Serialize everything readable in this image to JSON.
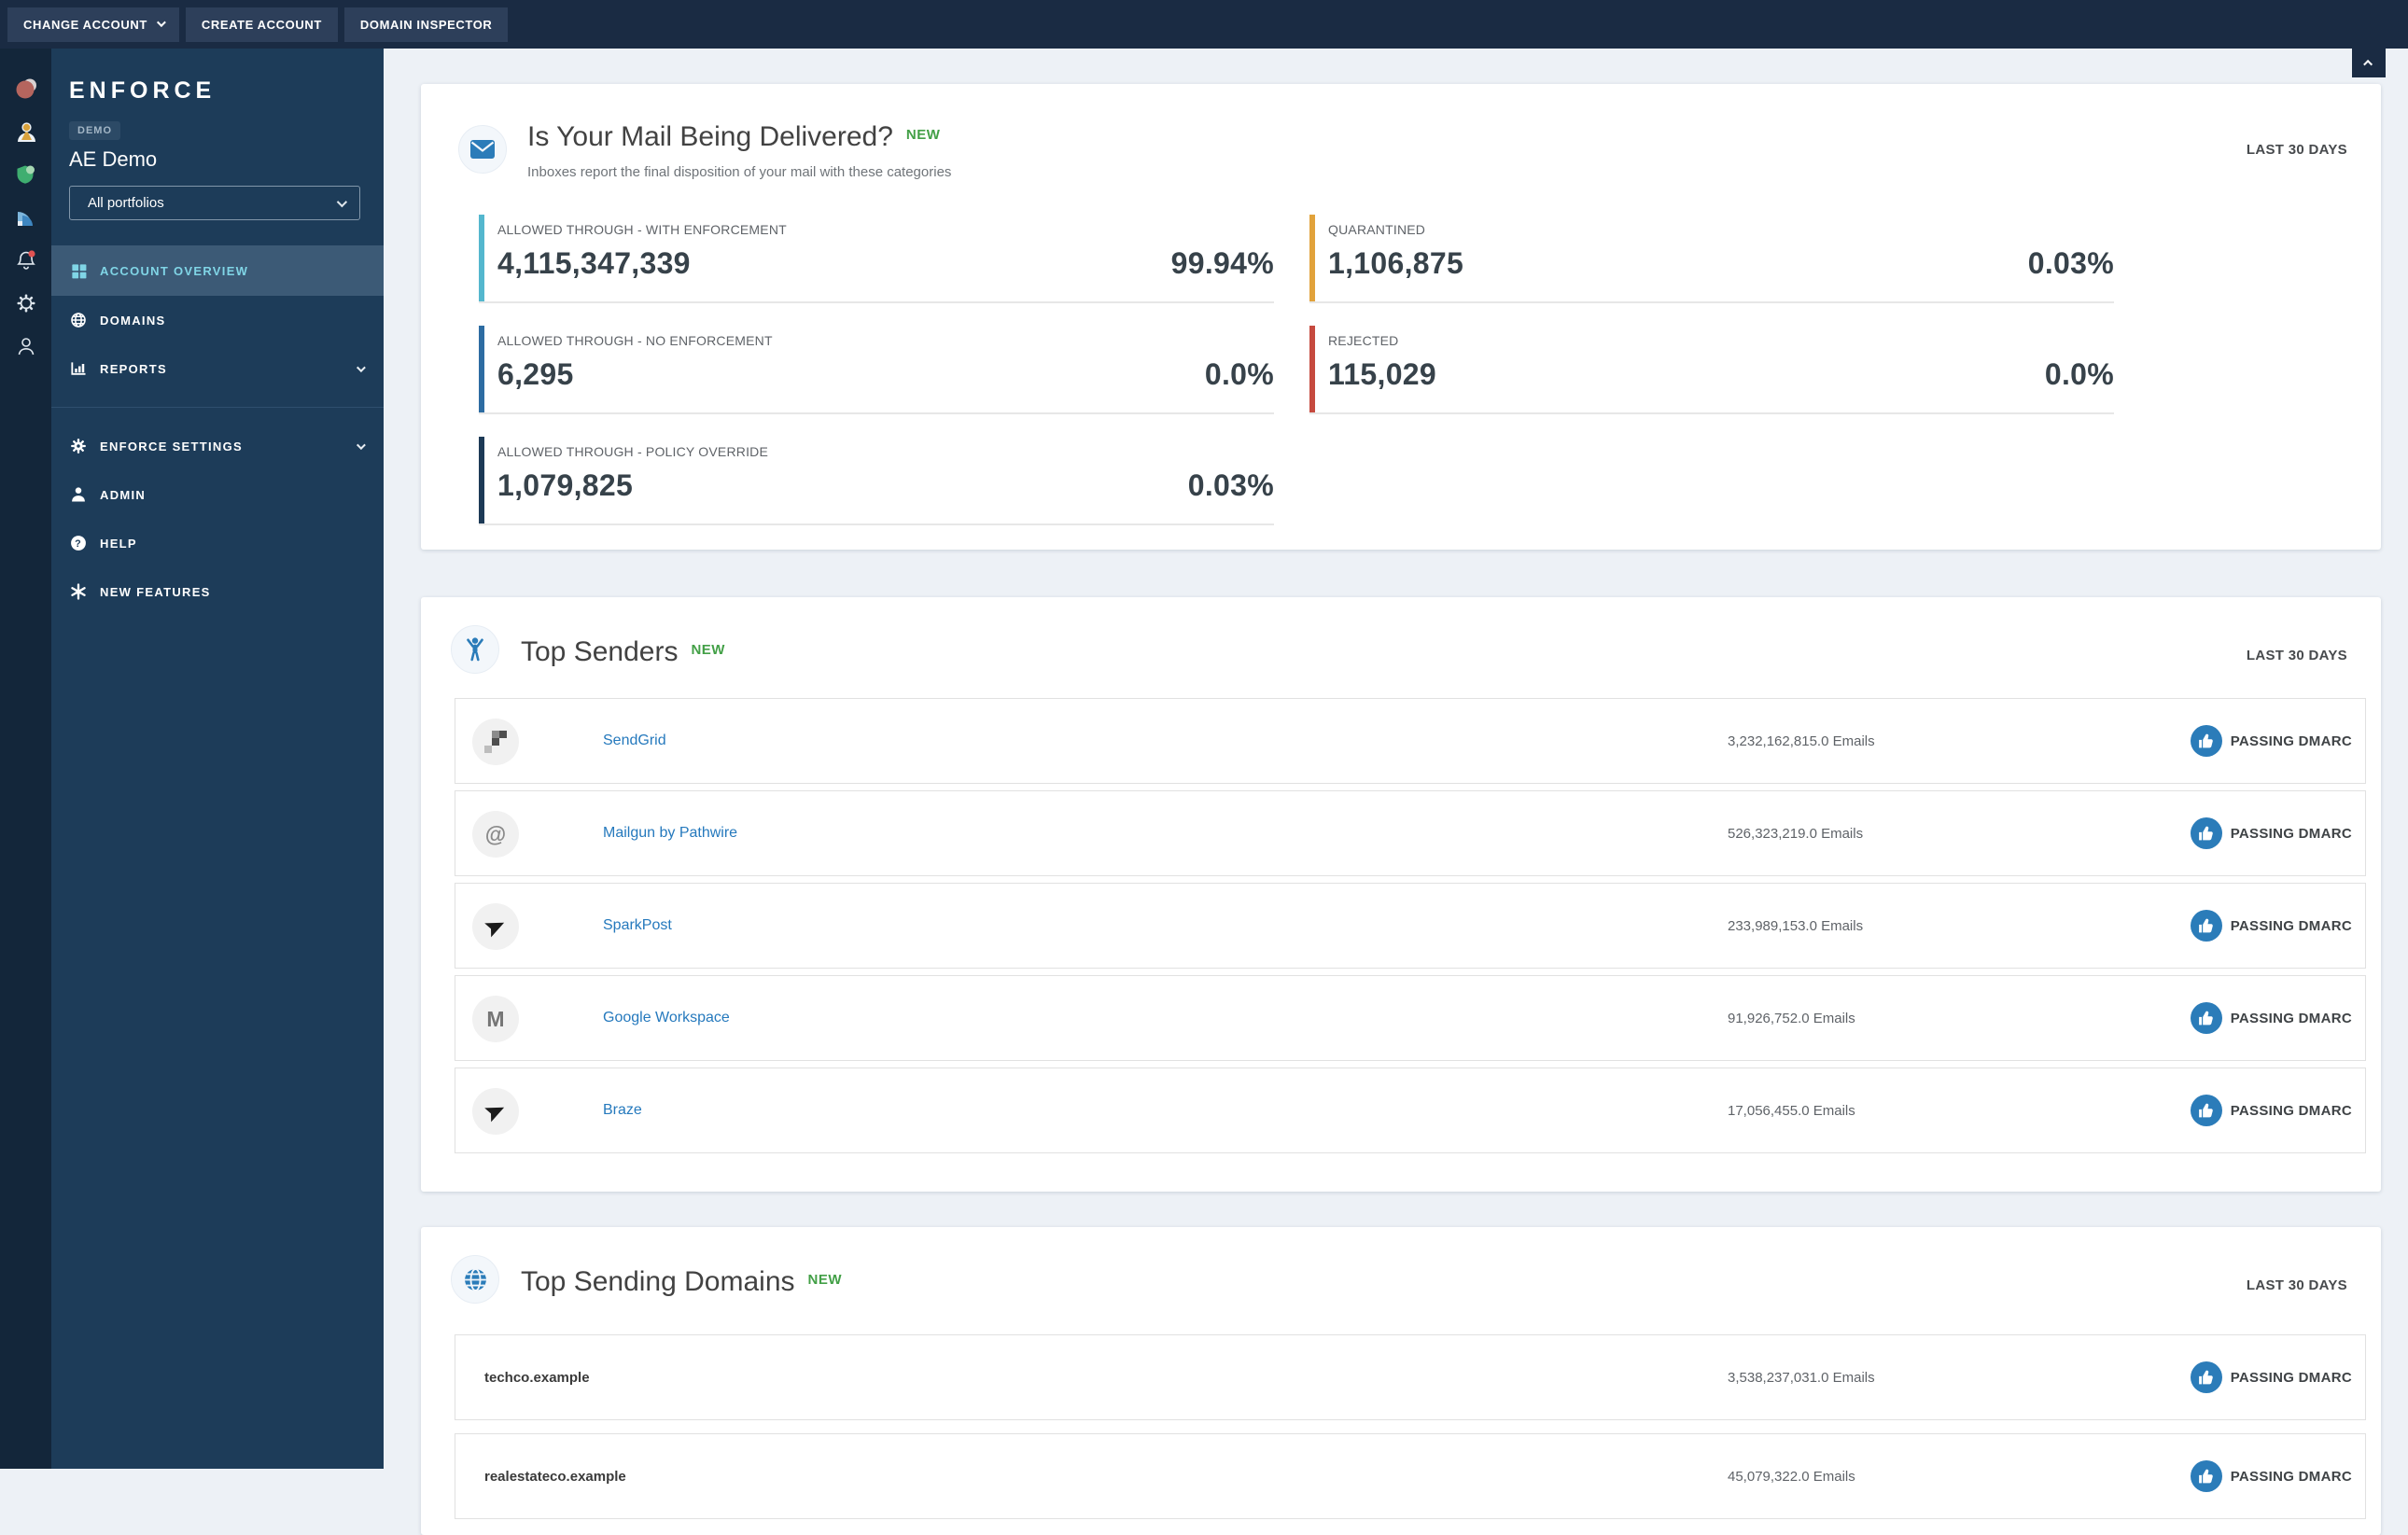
{
  "topbar": {
    "buttons": [
      {
        "label": "CHANGE ACCOUNT",
        "has_chevron": true
      },
      {
        "label": "CREATE ACCOUNT"
      },
      {
        "label": "DOMAIN INSPECTOR"
      }
    ]
  },
  "rail": {
    "icons": [
      "monitor-app-icon",
      "identity-app-icon",
      "enforce-app-icon",
      "reports-app-icon",
      "notifications-bell-icon",
      "settings-gear-icon",
      "user-profile-icon"
    ]
  },
  "sidebar": {
    "logo": "ENFORCE",
    "env_badge": "DEMO",
    "account_name": "AE Demo",
    "portfolio_selector": {
      "value": "All portfolios"
    },
    "menu": [
      {
        "label": "ACCOUNT OVERVIEW",
        "active": true
      },
      {
        "label": "DOMAINS"
      },
      {
        "label": "REPORTS",
        "expandable": true
      },
      {
        "label": "ENFORCE SETTINGS",
        "expandable": true
      },
      {
        "label": "ADMIN"
      },
      {
        "label": "HELP"
      },
      {
        "label": "NEW FEATURES"
      }
    ]
  },
  "delivery_card": {
    "title": "Is Your Mail Being Delivered?",
    "badge": "NEW",
    "subtitle": "Inboxes report the final disposition of your mail with these categories",
    "period": "LAST 30 DAYS",
    "stats": [
      {
        "label": "ALLOWED THROUGH - WITH ENFORCEMENT",
        "value": "4,115,347,339",
        "percent": "99.94%",
        "color": "#54b7ce"
      },
      {
        "label": "ALLOWED THROUGH - NO ENFORCEMENT",
        "value": "6,295",
        "percent": "0.0%",
        "color": "#2d6ca2"
      },
      {
        "label": "ALLOWED THROUGH - POLICY OVERRIDE",
        "value": "1,079,825",
        "percent": "0.03%",
        "color": "#1d3a56"
      },
      {
        "label": "QUARANTINED",
        "value": "1,106,875",
        "percent": "0.03%",
        "color": "#e1a23b"
      },
      {
        "label": "REJECTED",
        "value": "115,029",
        "percent": "0.0%",
        "color": "#c64a3f"
      }
    ]
  },
  "top_senders": {
    "title": "Top Senders",
    "badge": "NEW",
    "period": "LAST 30 DAYS",
    "rows": [
      {
        "name": "SendGrid",
        "emails": "3,232,162,815.0 Emails",
        "status": "PASSING DMARC",
        "icon": "sendgrid-logo"
      },
      {
        "name": "Mailgun by Pathwire",
        "emails": "526,323,219.0 Emails",
        "status": "PASSING DMARC",
        "icon": "mailgun-logo",
        "icon_glyph": "@"
      },
      {
        "name": "SparkPost",
        "emails": "233,989,153.0 Emails",
        "status": "PASSING DMARC",
        "icon": "sparkpost-logo"
      },
      {
        "name": "Google Workspace",
        "emails": "91,926,752.0 Emails",
        "status": "PASSING DMARC",
        "icon": "google-workspace-logo",
        "icon_glyph": "M"
      },
      {
        "name": "Braze",
        "emails": "17,056,455.0 Emails",
        "status": "PASSING DMARC",
        "icon": "braze-logo"
      }
    ]
  },
  "top_sending_domains": {
    "title": "Top Sending Domains",
    "badge": "NEW",
    "period": "LAST 30 DAYS",
    "rows": [
      {
        "name": "techco.example",
        "emails": "3,538,237,031.0 Emails",
        "status": "PASSING DMARC"
      },
      {
        "name": "realestateco.example",
        "emails": "45,079,322.0 Emails",
        "status": "PASSING DMARC"
      }
    ]
  },
  "colors": {
    "topbar_bg": "#1a2b43",
    "rail_bg": "#13263a",
    "sidebar_bg": "#1d3c59",
    "sidebar_active_bg": "#3c5a76",
    "sidebar_active_text": "#80d5e6",
    "page_bg": "#edf1f6",
    "accent_blue": "#2b7cb9",
    "link_blue": "#2579bd",
    "new_green": "#43a047"
  }
}
